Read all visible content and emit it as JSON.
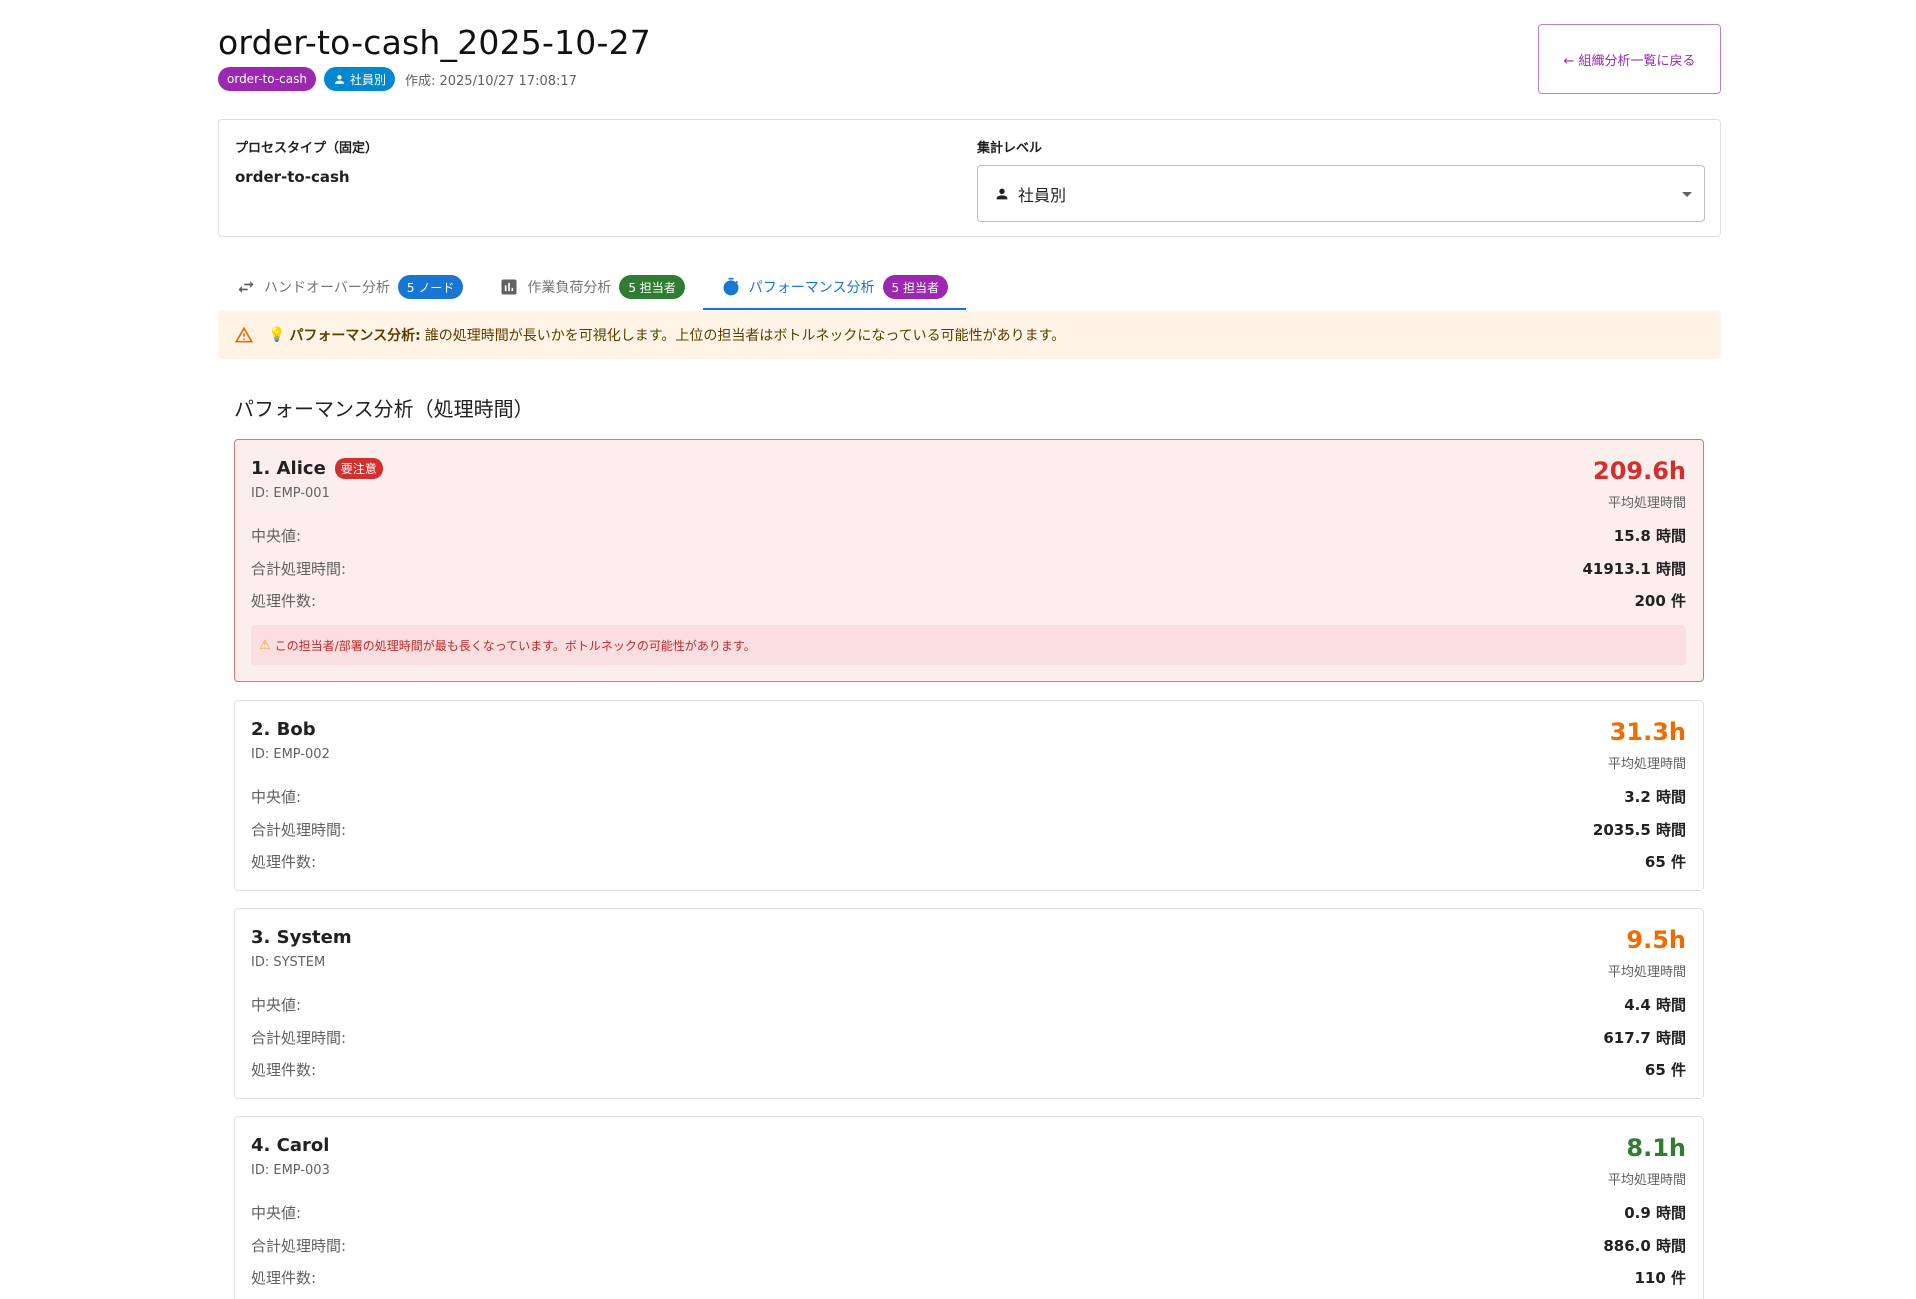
{
  "header": {
    "title": "order-to-cash_2025-10-27",
    "chip_process": "order-to-cash",
    "chip_level": "社員別",
    "created": "作成: 2025/10/27 17:08:17",
    "back_label": "← 組織分析一覧に戻る"
  },
  "config": {
    "process_label": "プロセスタイプ（固定）",
    "process_value": "order-to-cash",
    "level_label": "集計レベル",
    "level_value": "社員別"
  },
  "tabs": [
    {
      "label": "ハンドオーバー分析",
      "badge": "5 ノード",
      "icon": "swap-icon"
    },
    {
      "label": "作業負荷分析",
      "badge": "5 担当者",
      "icon": "bar-chart-icon"
    },
    {
      "label": "パフォーマンス分析",
      "badge": "5 担当者",
      "icon": "timer-icon"
    }
  ],
  "alert": {
    "bulb": "💡",
    "strong": "パフォーマンス分析:",
    "text": "誰の処理時間が長いかを可視化します。上位の担当者はボトルネックになっている可能性があります。"
  },
  "section_title": "パフォーマンス分析（処理時間）",
  "labels": {
    "avg": "平均処理時間",
    "median": "中央値:",
    "total": "合計処理時間:",
    "count": "処理件数:"
  },
  "performers": [
    {
      "name": "1. Alice",
      "tag": "要注意",
      "id": "ID: EMP-001",
      "avg": "209.6h",
      "median": "15.8 時間",
      "total": "41913.1 時間",
      "count": "200 件",
      "note": "この担当者/部署の処理時間が最も長くなっています。ボトルネックの可能性があります。"
    },
    {
      "name": "2. Bob",
      "id": "ID: EMP-002",
      "avg": "31.3h",
      "median": "3.2 時間",
      "total": "2035.5 時間",
      "count": "65 件"
    },
    {
      "name": "3. System",
      "id": "ID: SYSTEM",
      "avg": "9.5h",
      "median": "4.4 時間",
      "total": "617.7 時間",
      "count": "65 件"
    },
    {
      "name": "4. Carol",
      "id": "ID: EMP-003",
      "avg": "8.1h",
      "median": "0.9 時間",
      "total": "886.0 時間",
      "count": "110 件"
    }
  ],
  "colors": {
    "critical": "#d32f2f",
    "warning": "#ef6c00",
    "good": "#2e7d32",
    "accent": "#9c27b0",
    "primary": "#1976d2"
  }
}
